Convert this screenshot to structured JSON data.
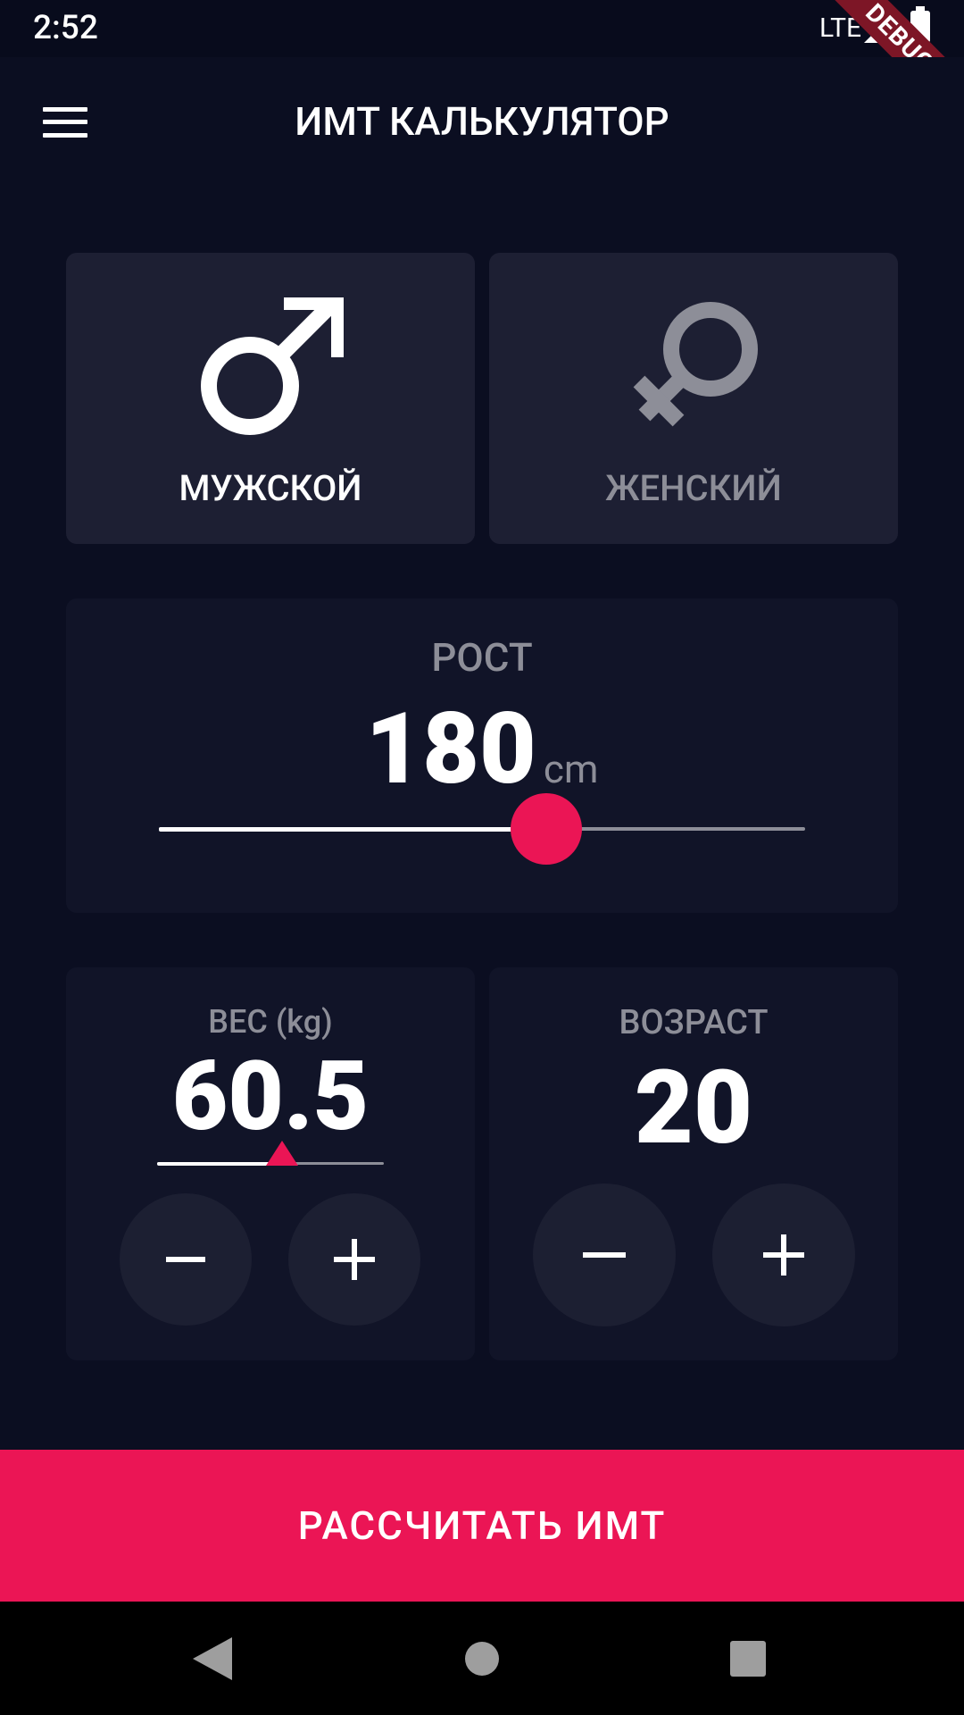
{
  "status_bar": {
    "time": "2:52",
    "network": "LTE",
    "debug_label": "DEBUG"
  },
  "app_bar": {
    "title": "ИМТ КАЛЬКУЛЯТОР",
    "menu_icon": "menu-icon"
  },
  "gender": {
    "male_label": "МУЖСКОЙ",
    "female_label": "ЖЕНСКИЙ",
    "male_icon": "male-symbol-icon",
    "female_icon": "female-symbol-icon",
    "selected": "male"
  },
  "height": {
    "label": "РОСТ",
    "value": "180",
    "unit": "cm",
    "slider_fraction": 0.6
  },
  "weight": {
    "label": "ВЕС (kg)",
    "value": "60.5",
    "slider_fraction": 0.55
  },
  "age": {
    "label": "ВОЗРАСТ",
    "value": "20"
  },
  "calculate_button": {
    "label": "РАССЧИТАТЬ ИМТ"
  },
  "colors": {
    "background": "#0b0e21",
    "card_active": "#1d1f33",
    "card_inactive": "#111428",
    "accent": "#eb1555",
    "muted_text": "#8d8e98"
  },
  "nav_bar": {
    "back_icon": "back-triangle-icon",
    "home_icon": "home-circle-icon",
    "recents_icon": "recents-square-icon"
  }
}
